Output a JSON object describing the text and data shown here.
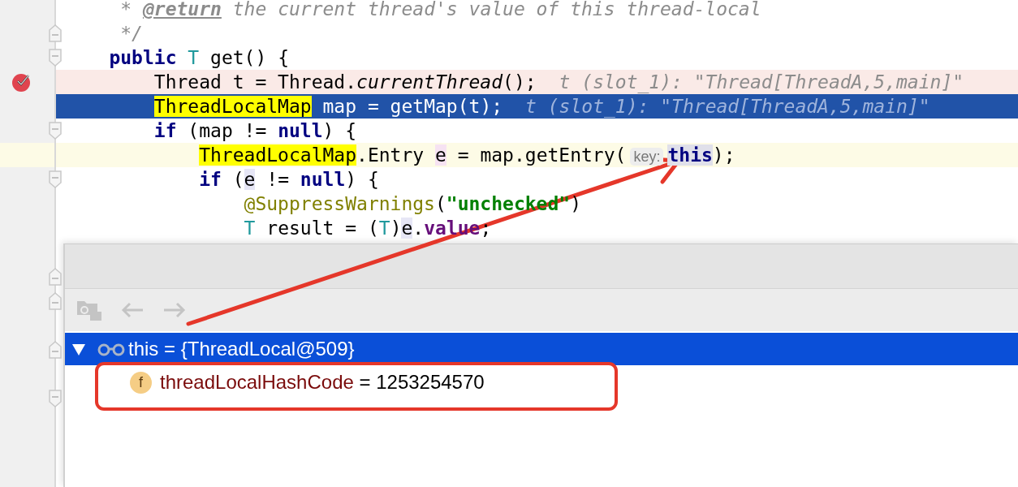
{
  "editor": {
    "lines": [
      {
        "tokens": [
          {
            "text": "     * ",
            "kind": "comment"
          },
          {
            "text": "@return",
            "kind": "doc-tag"
          },
          {
            "text": " the current thread's value of this thread-local",
            "kind": "comment"
          }
        ]
      },
      {
        "fold_end": true,
        "tokens": [
          {
            "text": "     */",
            "kind": "comment"
          }
        ]
      },
      {
        "fold_start": true,
        "tokens": [
          {
            "text": "    public",
            "kind": "keyword"
          },
          {
            "text": " T",
            "kind": "type"
          },
          {
            "text": " get() {",
            "kind": "plain"
          }
        ]
      },
      {
        "breakpoint": true,
        "tokens": [
          {
            "text": "        Thread t = Thread.",
            "kind": "plain"
          },
          {
            "text": "currentThread",
            "kind": "italic"
          },
          {
            "text": "();",
            "kind": "plain"
          }
        ],
        "hint": "t (slot_1): \"Thread[ThreadA,5,main]\""
      },
      {
        "execution": true,
        "tokens": [
          {
            "text": "        ThreadLocalMap",
            "kind": "highlight"
          },
          {
            "text": " map = getMap(t);",
            "kind": "plain"
          }
        ],
        "hint": "t (slot_1): \"Thread[ThreadA,5,main]\""
      },
      {
        "fold_start": true,
        "tokens": [
          {
            "text": "        if",
            "kind": "keyword"
          },
          {
            "text": " (map != ",
            "kind": "plain"
          },
          {
            "text": "null",
            "kind": "keyword"
          },
          {
            "text": ") {",
            "kind": "plain"
          }
        ]
      },
      {
        "caret": true,
        "tokens": [
          {
            "text": "            ThreadLocalMap",
            "kind": "highlight"
          },
          {
            "text": ".Entry ",
            "kind": "plain"
          },
          {
            "text": "e",
            "kind": "write"
          },
          {
            "text": " = map.getEntry(",
            "kind": "plain"
          },
          {
            "text": "key:",
            "kind": "param-hint"
          },
          {
            "text": "this",
            "kind": "ref"
          },
          {
            "text": ");",
            "kind": "plain"
          }
        ]
      },
      {
        "fold_start": true,
        "tokens": [
          {
            "text": "            if",
            "kind": "keyword"
          },
          {
            "text": " (",
            "kind": "plain"
          },
          {
            "text": "e",
            "kind": "usage"
          },
          {
            "text": " != ",
            "kind": "plain"
          },
          {
            "text": "null",
            "kind": "keyword"
          },
          {
            "text": ") {",
            "kind": "plain"
          }
        ]
      },
      {
        "tokens": [
          {
            "text": "                @SuppressWarnings",
            "kind": "annotation"
          },
          {
            "text": "(",
            "kind": "plain"
          },
          {
            "text": "\"unchecked\"",
            "kind": "string"
          },
          {
            "text": ")",
            "kind": "plain"
          }
        ]
      },
      {
        "tokens": [
          {
            "text": "                T",
            "kind": "type"
          },
          {
            "text": " result = (",
            "kind": "plain"
          },
          {
            "text": "T",
            "kind": "type"
          },
          {
            "text": ")",
            "kind": "plain"
          },
          {
            "text": "e",
            "kind": "usage"
          },
          {
            "text": ".",
            "kind": "plain"
          },
          {
            "text": "value",
            "kind": "field"
          },
          {
            "text": ";",
            "kind": "plain"
          }
        ]
      }
    ],
    "gutter_below": [
      {
        "fold_start": false
      },
      {
        "fold_start": false
      },
      {
        "fold_start": false
      },
      {
        "fold_start": true
      }
    ]
  },
  "popup": {
    "toolbar": [
      {
        "kind": "show-source",
        "disabled": true
      },
      {
        "kind": "back",
        "disabled": true
      },
      {
        "kind": "forward",
        "disabled": true
      }
    ],
    "tree": [
      {
        "kind": "watch",
        "name": "this",
        "value": " = {ThreadLocal@509}",
        "expanded": true,
        "selected": true,
        "children": [
          {
            "kind": "field",
            "icon_letter": "f",
            "name": "threadLocalHashCode",
            "value": " = 1253254570",
            "selected": false
          }
        ]
      }
    ]
  }
}
